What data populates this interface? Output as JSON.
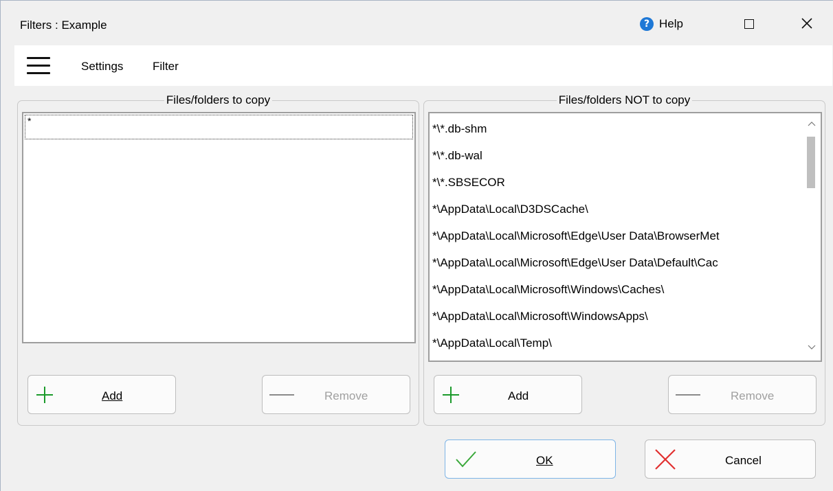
{
  "window": {
    "title": "Filters : Example"
  },
  "titlebar": {
    "help_label": "Help",
    "help_icon": "?"
  },
  "menu": {
    "items": [
      "Settings",
      "Filter"
    ]
  },
  "left_group": {
    "legend": "Files/folders to copy",
    "items": [
      "*"
    ],
    "add_label": "Add",
    "remove_label": "Remove"
  },
  "right_group": {
    "legend": "Files/folders NOT to copy",
    "items": [
      "*\\*.db-shm",
      "*\\*.db-wal",
      "*\\*.SBSECOR",
      "*\\AppData\\Local\\D3DSCache\\",
      "*\\AppData\\Local\\Microsoft\\Edge\\User Data\\BrowserMet",
      "*\\AppData\\Local\\Microsoft\\Edge\\User Data\\Default\\Cac",
      "*\\AppData\\Local\\Microsoft\\Windows\\Caches\\",
      "*\\AppData\\Local\\Microsoft\\WindowsApps\\",
      "*\\AppData\\Local\\Temp\\"
    ],
    "add_label": "Add",
    "remove_label": "Remove"
  },
  "dialog_buttons": {
    "ok_label": "OK",
    "cancel_label": "Cancel"
  },
  "colors": {
    "add_icon": "#1a9a2a",
    "ok_icon": "#3aa83a",
    "cancel_icon": "#e23030",
    "help_icon": "#1e78d6"
  }
}
